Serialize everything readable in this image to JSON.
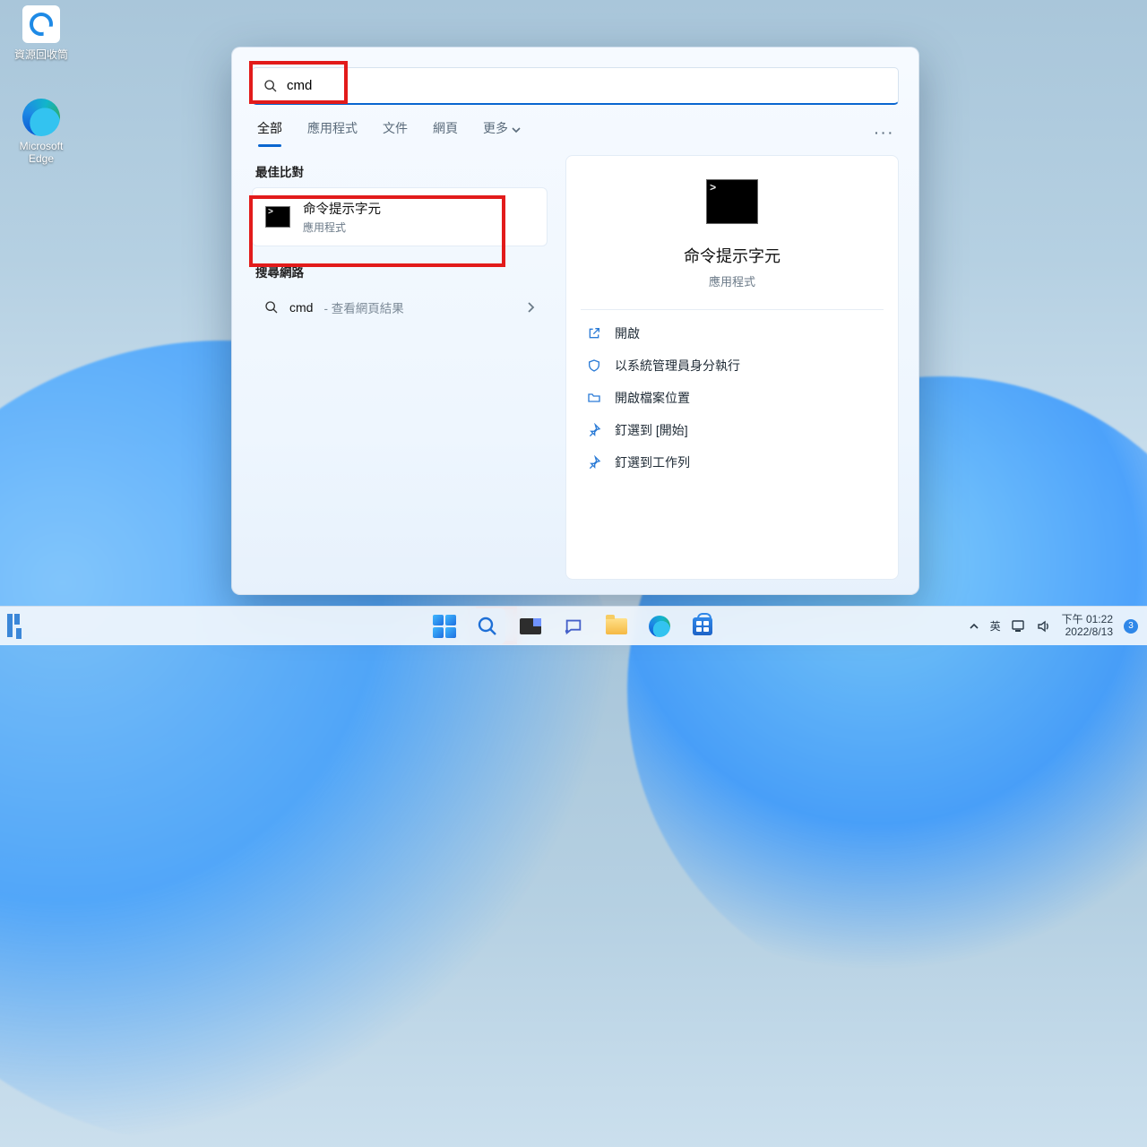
{
  "desktop": {
    "recycle_label": "資源回收筒",
    "edge_label": "Microsoft Edge"
  },
  "search": {
    "query": "cmd",
    "tabs": [
      "全部",
      "應用程式",
      "文件",
      "網頁",
      "更多"
    ],
    "best_match_label": "最佳比對",
    "result": {
      "title": "命令提示字元",
      "subtitle": "應用程式"
    },
    "web_label": "搜尋網路",
    "web_row": {
      "term": "cmd",
      "suffix": " - 查看網頁結果"
    }
  },
  "preview": {
    "title": "命令提示字元",
    "subtitle": "應用程式",
    "actions": [
      "開啟",
      "以系統管理員身分執行",
      "開啟檔案位置",
      "釘選到 [開始]",
      "釘選到工作列"
    ]
  },
  "tray": {
    "ime": "英",
    "time": "下午 01:22",
    "date": "2022/8/13",
    "badge": "3"
  }
}
